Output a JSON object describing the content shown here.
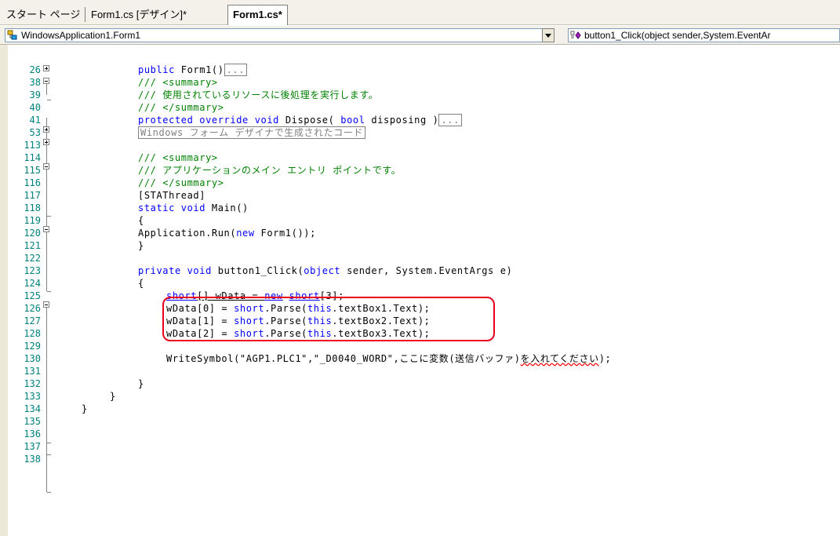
{
  "tabs": [
    {
      "label": "スタート ページ"
    },
    {
      "label": "Form1.cs [デザイン]*"
    },
    {
      "label": "Form1.cs*",
      "active": true
    }
  ],
  "nav": {
    "class_combo": "WindowsApplication1.Form1",
    "member_combo": "button1_Click(object sender,System.EventAr"
  },
  "lines": [
    {
      "num": "26"
    },
    {
      "num": "38"
    },
    {
      "num": "39"
    },
    {
      "num": "40"
    },
    {
      "num": "41"
    },
    {
      "num": "53"
    },
    {
      "num": "113"
    },
    {
      "num": "114"
    },
    {
      "num": "115"
    },
    {
      "num": "116"
    },
    {
      "num": "117"
    },
    {
      "num": "118"
    },
    {
      "num": "119"
    },
    {
      "num": "120"
    },
    {
      "num": "121"
    },
    {
      "num": "122"
    },
    {
      "num": "123"
    },
    {
      "num": "124"
    },
    {
      "num": "125"
    },
    {
      "num": "126"
    },
    {
      "num": "127"
    },
    {
      "num": "128"
    },
    {
      "num": "129"
    },
    {
      "num": "130"
    },
    {
      "num": "131"
    },
    {
      "num": "132"
    },
    {
      "num": "133"
    },
    {
      "num": "134"
    },
    {
      "num": "135"
    },
    {
      "num": "136"
    },
    {
      "num": "137"
    },
    {
      "num": "138"
    }
  ],
  "code": {
    "l26_kw": "public",
    "l26_text": " Form1()",
    "l26_collapsed": "...",
    "l38": "/// <summary>",
    "l39": "/// 使用されているリソースに後処理を実行します。",
    "l40": "/// </summary>",
    "l41_kw1": "protected",
    "l41_kw2": "override",
    "l41_kw3": "void",
    "l41_text1": " Dispose( ",
    "l41_kw4": "bool",
    "l41_text2": " disposing )",
    "l41_collapsed": "...",
    "l53_region": "Windows フォーム デザイナで生成されたコード",
    "l114": "/// <summary>",
    "l115": "/// アプリケーションのメイン エントリ ポイントです。",
    "l116": "/// </summary>",
    "l117": "[STAThread]",
    "l118_kw1": "static",
    "l118_kw2": "void",
    "l118_text": " Main()",
    "l119": "{",
    "l120_text1": "    Application.Run(",
    "l120_kw": "new",
    "l120_text2": " Form1());",
    "l121": "}",
    "l123_kw1": "private",
    "l123_kw2": "void",
    "l123_text1": " button1_Click(",
    "l123_kw3": "object",
    "l123_text2": " sender, System.EventArgs e)",
    "l124": "{",
    "l125_kw1": "short",
    "l125_text1": "[] wData = ",
    "l125_kw2": "new",
    "l125_kw3": "short",
    "l125_text2": "[3];",
    "l126_text1": "wData[0] = ",
    "l126_kw1": "short",
    "l126_text2": ".Parse(",
    "l126_kw2": "this",
    "l126_text3": ".textBox1.Text);",
    "l127_text1": "wData[1] = ",
    "l127_kw1": "short",
    "l127_text2": ".Parse(",
    "l127_kw2": "this",
    "l127_text3": ".textBox2.Text);",
    "l128_text1": "wData[2] = ",
    "l128_kw1": "short",
    "l128_text2": ".Parse(",
    "l128_kw2": "this",
    "l128_text3": ".textBox3.Text);",
    "l130_text1": "WriteSymbol(\"AGP1.PLC1\",\"_D0040_WORD\",ここに変数(送信バッファ)",
    "l130_err": "を入れてください",
    "l130_text2": ");",
    "l132": "}",
    "l133": "}",
    "l134": "}"
  },
  "colors": {
    "keyword": "#0000ff",
    "comment": "#008000",
    "line_number": "#008080",
    "highlight_box": "#e8001c"
  }
}
